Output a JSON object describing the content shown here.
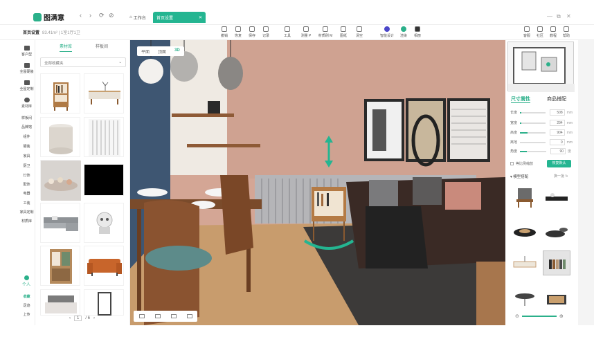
{
  "app": {
    "name": "图满意"
  },
  "nav": {
    "back": "‹",
    "forward": "›",
    "refresh": "⟳",
    "link": "⊘"
  },
  "tabs": [
    {
      "label": "工作台"
    },
    {
      "label": "首页设置"
    }
  ],
  "window": {
    "minimize": "—",
    "restore": "⧉",
    "close": "✕"
  },
  "breadcrumb": {
    "title": "首页设置",
    "sub": "83.41m² | 1室1厅1卫"
  },
  "toolbar": {
    "left": [
      {
        "label": "撤销",
        "icon": "undo-icon"
      },
      {
        "label": "恢复",
        "icon": "redo-icon"
      },
      {
        "label": "保存",
        "icon": "save-icon"
      },
      {
        "label": "记录",
        "icon": "history-icon"
      }
    ],
    "mid": [
      {
        "label": "工具",
        "icon": "tool-icon"
      },
      {
        "label": "测量 P",
        "icon": "measure-icon"
      },
      {
        "label": "材质刷 M",
        "icon": "brush-icon"
      },
      {
        "label": "图纸",
        "icon": "drawing-icon"
      },
      {
        "label": "清空",
        "icon": "clear-icon"
      }
    ],
    "render": [
      {
        "label": "智能设计",
        "icon": "ai-icon"
      },
      {
        "label": "渲染",
        "icon": "render-icon"
      },
      {
        "label": "相册",
        "icon": "album-icon"
      }
    ],
    "right": [
      {
        "label": "客服",
        "icon": "support-icon"
      },
      {
        "label": "社区",
        "icon": "community-icon"
      },
      {
        "label": "教程",
        "icon": "tutorial-icon"
      },
      {
        "label": "帮助",
        "icon": "help-icon"
      }
    ]
  },
  "rail": [
    "客户型",
    "全屋硬装",
    "全屋定制",
    "素材库",
    "样板间",
    "品牌馆",
    "组件",
    "硬装",
    "家具",
    "厨卫",
    "灯饰",
    "配饰",
    "电器",
    "工装",
    "家具定制",
    "材质库"
  ],
  "rail_bottom": {
    "personal": "个人",
    "collect": "收藏",
    "recent": "足迹",
    "upload": "上传"
  },
  "panel": {
    "tab_material": "素材库",
    "tab_sample": "样板间",
    "category_placeholder": "全部收藏夹",
    "page_current": "1",
    "page_total": "/ 6",
    "prev": "‹",
    "next": "›"
  },
  "materials": [
    "bookshelf",
    "side-table",
    "stool",
    "curtain",
    "figurines",
    "black-panel",
    "sofa",
    "robot-figure",
    "cabinet",
    "armchair",
    "bed",
    "tall-cabinet"
  ],
  "scene": {
    "view_plan": "平面",
    "view_ceiling": "顶面",
    "view_3d": "3D"
  },
  "props": {
    "tab_size": "尺寸属性",
    "tab_match": "商品搭配",
    "rows": [
      {
        "label": "长度",
        "value": "508",
        "unit": "mm",
        "level": 0.05
      },
      {
        "label": "宽度",
        "value": "294",
        "unit": "mm",
        "level": 0.05
      },
      {
        "label": "高度",
        "value": "904",
        "unit": "mm",
        "level": 0.3
      },
      {
        "label": "离地",
        "value": "0",
        "unit": "mm",
        "level": 0.0
      },
      {
        "label": "角度",
        "value": "90",
        "unit": "度",
        "level": 0.25
      }
    ],
    "lock_label": "等比例缩放",
    "reset_label": "恢复默认",
    "model_title": "▾ 模型搭配",
    "model_more": "换一批 ↻"
  },
  "zoom": {
    "minus": "⊖",
    "plus": "⊕"
  }
}
